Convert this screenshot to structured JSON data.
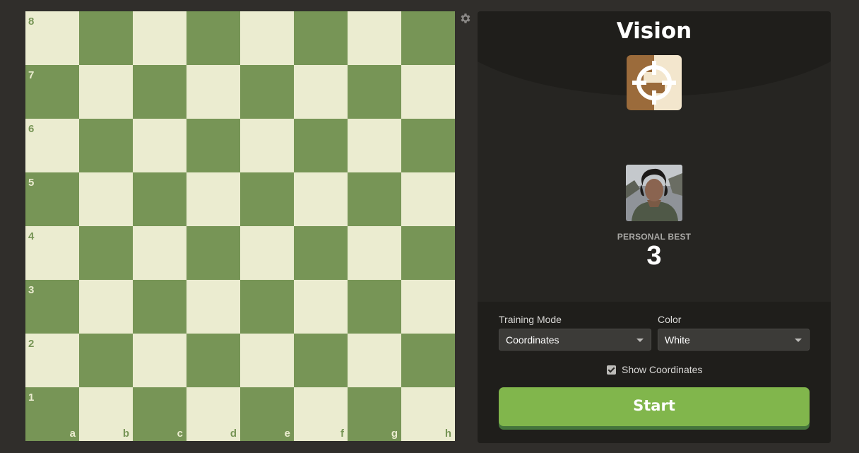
{
  "board": {
    "ranks": [
      "8",
      "7",
      "6",
      "5",
      "4",
      "3",
      "2",
      "1"
    ],
    "files": [
      "a",
      "b",
      "c",
      "d",
      "e",
      "f",
      "g",
      "h"
    ]
  },
  "panel": {
    "title": "Vision",
    "personal_best_label": "PERSONAL BEST",
    "personal_best_value": "3"
  },
  "controls": {
    "training_mode_label": "Training Mode",
    "training_mode_value": "Coordinates",
    "color_label": "Color",
    "color_value": "White",
    "show_coordinates_label": "Show Coordinates",
    "show_coordinates_checked": true,
    "start_label": "Start"
  },
  "colors": {
    "light_square": "#ebecd0",
    "dark_square": "#779556",
    "start_button": "#81b64c"
  }
}
